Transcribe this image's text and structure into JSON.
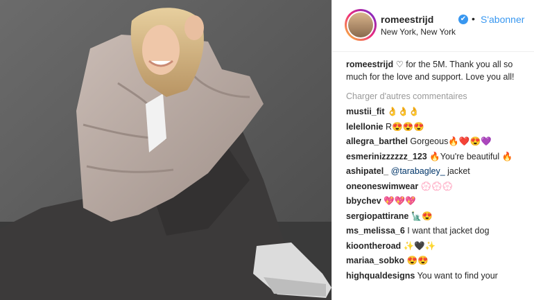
{
  "header": {
    "username": "romeestrijd",
    "verified_glyph": "✔",
    "separator": "•",
    "follow_label": "S'abonner",
    "location": "New York, New York"
  },
  "caption": {
    "username": "romeestrijd",
    "text": "♡ for the 5M. Thank you all so much for the love and support. Love you all!"
  },
  "load_more_label": "Charger d'autres commentaires",
  "comments": [
    {
      "username": "mustii_fit",
      "text": "👌👌👌"
    },
    {
      "username": "lelellonie",
      "text": "R😍😍😍"
    },
    {
      "username": "allegra_barthel",
      "text": "Gorgeous🔥❤️😍💜"
    },
    {
      "username": "esmerinizzzzzz_123",
      "text": "🔥You're beautiful 🔥"
    },
    {
      "username": "ashipatel_",
      "mention": "@tarabagley_",
      "text": " jacket"
    },
    {
      "username": "oneoneswimwear",
      "text": "💮💮💮"
    },
    {
      "username": "bbychev",
      "text": "💖💖💖"
    },
    {
      "username": "sergiopattirane",
      "text": "🗽😍"
    },
    {
      "username": "ms_melissa_6",
      "text": "I want that jacket dog"
    },
    {
      "username": "kioontheroad",
      "text": "✨🖤✨"
    },
    {
      "username": "mariaa_sobko",
      "text": "😍😍"
    },
    {
      "username": "highqualdesigns",
      "text": "You want to find your"
    }
  ],
  "colors": {
    "link_blue": "#3897f0",
    "text": "#262626",
    "muted": "#999999",
    "jacket": "#b9aaa3",
    "pants": "#3c3a3a",
    "wall": "#5a5a5a"
  }
}
